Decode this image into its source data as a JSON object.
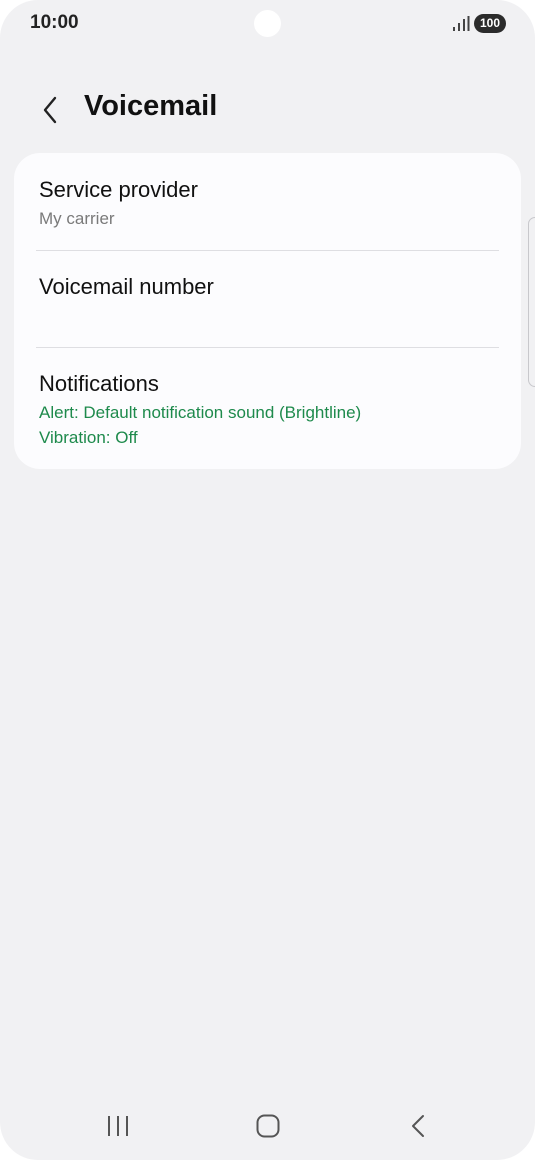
{
  "status_bar": {
    "time": "10:00",
    "battery": "100",
    "icons": [
      "signal-icon",
      "battery-icon"
    ]
  },
  "header": {
    "title": "Voicemail",
    "back_icon": "back-chevron-icon"
  },
  "settings": {
    "service_provider": {
      "title": "Service provider",
      "value": "My carrier"
    },
    "voicemail_number": {
      "title": "Voicemail number"
    },
    "notifications": {
      "title": "Notifications",
      "alert": "Alert: Default notification sound (Brightline)",
      "vibration": "Vibration: Off"
    }
  },
  "nav_bar": {
    "icons": [
      "recent-apps-icon",
      "home-icon",
      "back-icon"
    ]
  },
  "colors": {
    "background": "#f1f1f3",
    "card": "#fcfcfe",
    "accent_green": "#1e8a4c",
    "secondary_text": "#7a7a7a"
  }
}
